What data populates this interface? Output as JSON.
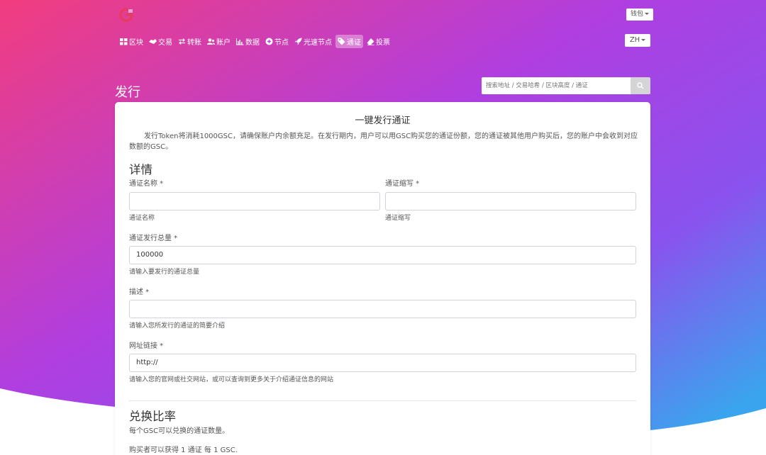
{
  "colors": {
    "gradient_start": "#f23d7e",
    "gradient_mid": "#b03ee0",
    "gradient_end": "#3aa5ee",
    "brand_logo": "#e63b5a"
  },
  "header": {
    "logo_icon": "gsc-logo-icon",
    "wallet_label": "钱包",
    "lang_label": "ZH"
  },
  "nav": {
    "items": [
      {
        "label": "区块",
        "icon": "grid-icon"
      },
      {
        "label": "交易",
        "icon": "handshake-icon"
      },
      {
        "label": "转账",
        "icon": "exchange-icon"
      },
      {
        "label": "账户",
        "icon": "users-icon"
      },
      {
        "label": "数据",
        "icon": "bar-chart-icon"
      },
      {
        "label": "节点",
        "icon": "circle-plus-icon"
      },
      {
        "label": "光速节点",
        "icon": "rocket-icon"
      },
      {
        "label": "通证",
        "icon": "tag-icon",
        "active": true
      },
      {
        "label": "投票",
        "icon": "eraser-icon"
      }
    ]
  },
  "page": {
    "title": "发行"
  },
  "search": {
    "placeholder": "搜索地址 / 交易哈希 / 区块高度 / 通证"
  },
  "form": {
    "title": "一键发行通证",
    "intro": "发行Token将消耗1000GSC，请确保账户内余额充足。在发行期内，用户可以用GSC购买您的通证份额，您的通证被其他用户购买后，您的账户中会收到对应数额的GSC。",
    "details_heading": "详情",
    "name_label": "通证名称 *",
    "name_help": "通证名称",
    "abbr_label": "通证缩写 *",
    "abbr_help": "通证缩写",
    "supply_label": "通证发行总量 *",
    "supply_value": "100000",
    "supply_help": "请输入要发行的通证总量",
    "desc_label": "描述 *",
    "desc_help": "请输入您所发行的通证的简要介绍",
    "url_label": "网址链接 *",
    "url_value": "http://",
    "url_help": "请输入您的官网或社交网站，或可以查询到更多关于介绍通证信息的网站",
    "ratio_heading": "兑换比率",
    "ratio_sub": "每个GSC可以兑换的通证数量。",
    "ratio_text": "购买者可以获得 1 通证 每 1 GSC."
  }
}
